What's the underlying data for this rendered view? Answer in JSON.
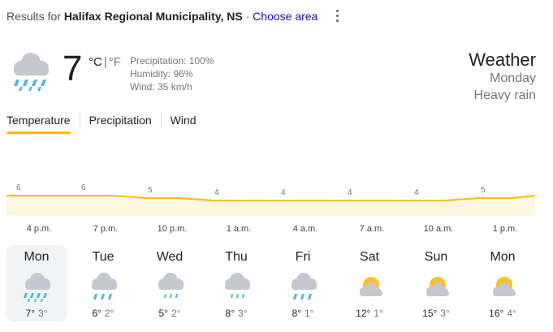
{
  "header": {
    "results_prefix": "Results for",
    "location": "Halifax Regional Municipality, NS",
    "separator": "·",
    "choose_area": "Choose area"
  },
  "current": {
    "icon": "heavy-rain-icon",
    "temperature": "7",
    "unit_c": "°C",
    "unit_sep": "|",
    "unit_f": "°F",
    "precipitation": "Precipitation: 100%",
    "humidity": "Humidity: 96%",
    "wind": "Wind: 35 km/h"
  },
  "summary": {
    "title": "Weather",
    "day": "Monday",
    "condition": "Heavy rain"
  },
  "tabs": [
    {
      "label": "Temperature",
      "active": true
    },
    {
      "label": "Precipitation",
      "active": false
    },
    {
      "label": "Wind",
      "active": false
    }
  ],
  "chart_data": {
    "type": "area",
    "series": [
      {
        "values": [
          6,
          6,
          5,
          4,
          4,
          4,
          4,
          5
        ]
      }
    ],
    "point_labels": [
      "6",
      "6",
      "5",
      "4",
      "4",
      "4",
      "4",
      "5"
    ],
    "time_labels": [
      "4 p.m.",
      "7 p.m.",
      "10 p.m.",
      "1 a.m.",
      "4 a.m.",
      "7 a.m.",
      "10 a.m.",
      "1 p.m."
    ],
    "colors": {
      "line": "#fbbc04",
      "fill": "#fef7e0",
      "label": "#70757a"
    }
  },
  "forecast": [
    {
      "day": "Mon",
      "icon": "heavy-rain-icon",
      "high": "7°",
      "low": "3°",
      "selected": true
    },
    {
      "day": "Tue",
      "icon": "rain-icon",
      "high": "6°",
      "low": "2°",
      "selected": false
    },
    {
      "day": "Wed",
      "icon": "light-rain-icon",
      "high": "5°",
      "low": "2°",
      "selected": false
    },
    {
      "day": "Thu",
      "icon": "light-rain-icon",
      "high": "8°",
      "low": "3°",
      "selected": false
    },
    {
      "day": "Fri",
      "icon": "rain-icon",
      "high": "8°",
      "low": "1°",
      "selected": false
    },
    {
      "day": "Sat",
      "icon": "partly-cloudy-icon",
      "high": "12°",
      "low": "1°",
      "selected": false
    },
    {
      "day": "Sun",
      "icon": "partly-cloudy-icon",
      "high": "15°",
      "low": "3°",
      "selected": false
    },
    {
      "day": "Mon",
      "icon": "partly-cloudy-icon",
      "high": "16°",
      "low": "4°",
      "selected": false
    }
  ]
}
